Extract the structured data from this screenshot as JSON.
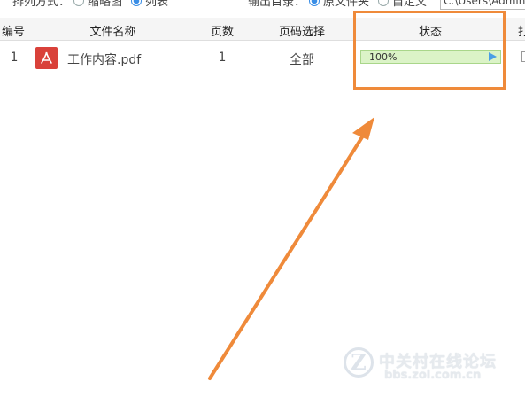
{
  "options": {
    "sort_label": "排列方式：",
    "sort_options": [
      "缩略图",
      "列表"
    ],
    "sort_selected": "列表",
    "output_label": "输出目录：",
    "output_options": [
      "原文件夹",
      "自定义"
    ],
    "output_selected": "原文件夹",
    "output_path": "C:\\Users\\Admin"
  },
  "table": {
    "columns": [
      "编号",
      "文件名称",
      "页数",
      "页码选择",
      "状态",
      "打"
    ],
    "rows": [
      {
        "index": "1",
        "file_name": "工作内容.pdf",
        "pages": "1",
        "page_selection": "全部",
        "status": "100%",
        "progress_fraction": 1.0
      }
    ]
  },
  "icons": {
    "file_icon": "pdf-file-icon",
    "status_action": "play-icon"
  },
  "colors": {
    "highlight": "#ef8a3a",
    "progress_fill": "#dbf3c7",
    "progress_border": "#a9d68a",
    "play": "#4a9ee6",
    "pdf_icon": "#d9413a"
  },
  "watermark": {
    "logo_letter": "Z",
    "name": "中关村在线论坛",
    "url": "bbs.zol.com.cn"
  }
}
